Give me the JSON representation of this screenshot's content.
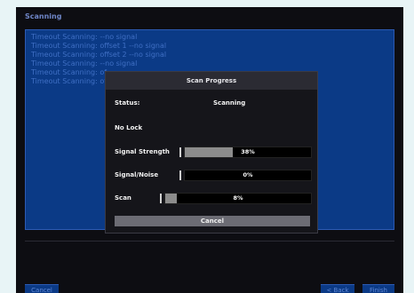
{
  "window": {
    "title": "Scanning"
  },
  "log": {
    "lines": [
      "Timeout Scanning: --no signal",
      "Timeout Scanning: offset 1 --no signal",
      "Timeout Scanning: offset 2 --no signal",
      "Timeout Scanning: --no signal",
      "Timeout Scanning: of",
      "Timeout Scanning: of"
    ]
  },
  "dialog": {
    "title": "Scan Progress",
    "status_label": "Status:",
    "status_value": "Scanning",
    "lock_text": "No Lock",
    "signal_strength": {
      "label": "Signal Strength",
      "percent_text": "38%",
      "value": 0.38
    },
    "signal_noise": {
      "label": "Signal/Noise",
      "percent_text": "0%",
      "value": 0.0
    },
    "scan": {
      "label": "Scan",
      "percent_text": "8%",
      "value": 0.08
    },
    "cancel_label": "Cancel"
  },
  "bottom_bar": {
    "cancel_label": "Cancel",
    "back_label": "< Back",
    "finish_label": "Finish"
  },
  "colors": {
    "log_background": "#0b3a86",
    "log_text": "#3f6fc4",
    "bar_fill": "#8c8c8c"
  }
}
